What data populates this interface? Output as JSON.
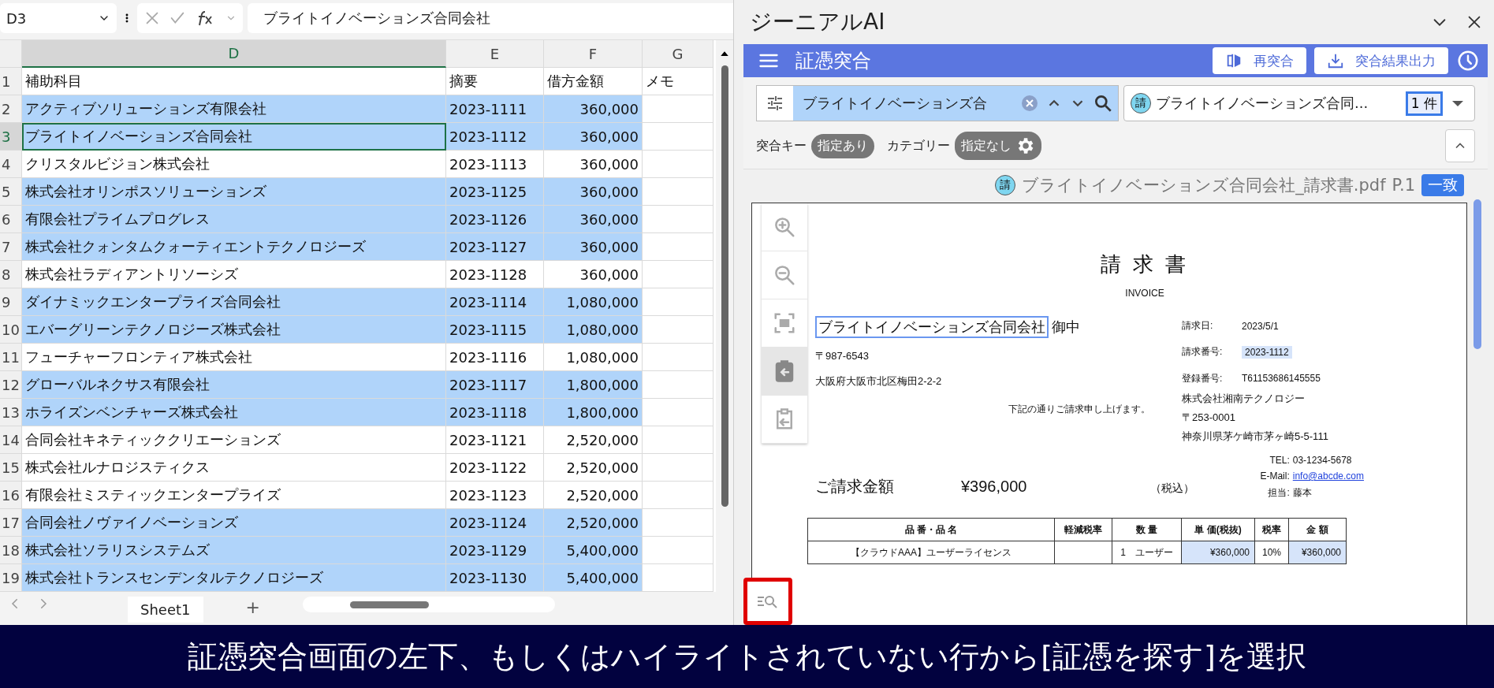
{
  "formula_bar": {
    "cell_ref": "D3",
    "value": "ブライトイノベーションズ合同会社"
  },
  "sheet": {
    "columns": [
      {
        "label": "D",
        "selected": true
      },
      {
        "label": "E",
        "selected": false
      },
      {
        "label": "F",
        "selected": false
      },
      {
        "label": "G",
        "selected": false
      }
    ],
    "rows": [
      {
        "number": "1",
        "cells": [
          "補助科目",
          "摘要",
          "借方金額",
          "メモ"
        ],
        "highlighted": false,
        "active": false
      },
      {
        "number": "2",
        "cells": [
          "アクティブソリューションズ有限会社",
          "2023-1111",
          "360,000"
        ],
        "highlighted": true,
        "active": false
      },
      {
        "number": "3",
        "cells": [
          "ブライトイノベーションズ合同会社",
          "2023-1112",
          "360,000"
        ],
        "highlighted": true,
        "active": true
      },
      {
        "number": "4",
        "cells": [
          "クリスタルビジョン株式会社",
          "2023-1113",
          "360,000"
        ],
        "highlighted": false,
        "active": false
      },
      {
        "number": "5",
        "cells": [
          "株式会社オリンポスソリューションズ",
          "2023-1125",
          "360,000"
        ],
        "highlighted": true,
        "active": false
      },
      {
        "number": "6",
        "cells": [
          "有限会社プライムプログレス",
          "2023-1126",
          "360,000"
        ],
        "highlighted": true,
        "active": false
      },
      {
        "number": "7",
        "cells": [
          "株式会社クォンタムクォーティエントテクノロジーズ",
          "2023-1127",
          "360,000"
        ],
        "highlighted": true,
        "active": false
      },
      {
        "number": "8",
        "cells": [
          "株式会社ラディアントリソーシズ",
          "2023-1128",
          "360,000"
        ],
        "highlighted": false,
        "active": false
      },
      {
        "number": "9",
        "cells": [
          "ダイナミックエンタープライズ合同会社",
          "2023-1114",
          "1,080,000"
        ],
        "highlighted": true,
        "active": false
      },
      {
        "number": "10",
        "cells": [
          "エバーグリーンテクノロジーズ株式会社",
          "2023-1115",
          "1,080,000"
        ],
        "highlighted": true,
        "active": false
      },
      {
        "number": "11",
        "cells": [
          "フューチャーフロンティア株式会社",
          "2023-1116",
          "1,080,000"
        ],
        "highlighted": false,
        "active": false
      },
      {
        "number": "12",
        "cells": [
          "グローバルネクサス有限会社",
          "2023-1117",
          "1,800,000"
        ],
        "highlighted": true,
        "active": false
      },
      {
        "number": "13",
        "cells": [
          "ホライズンベンチャーズ株式会社",
          "2023-1118",
          "1,800,000"
        ],
        "highlighted": true,
        "active": false
      },
      {
        "number": "14",
        "cells": [
          "合同会社キネティッククリエーションズ",
          "2023-1121",
          "2,520,000"
        ],
        "highlighted": false,
        "active": false
      },
      {
        "number": "15",
        "cells": [
          "株式会社ルナロジスティクス",
          "2023-1122",
          "2,520,000"
        ],
        "highlighted": false,
        "active": false
      },
      {
        "number": "16",
        "cells": [
          "有限会社ミスティックエンタープライズ",
          "2023-1123",
          "2,520,000"
        ],
        "highlighted": false,
        "active": false
      },
      {
        "number": "17",
        "cells": [
          "合同会社ノヴァイノベーションズ",
          "2023-1124",
          "2,520,000"
        ],
        "highlighted": true,
        "active": false
      },
      {
        "number": "18",
        "cells": [
          "株式会社ソラリスシステムズ",
          "2023-1129",
          "5,400,000"
        ],
        "highlighted": true,
        "active": false
      },
      {
        "number": "19",
        "cells": [
          "株式会社トランスセンデンタルテクノロジーズ",
          "2023-1130",
          "5,400,000"
        ],
        "highlighted": true,
        "active": false
      }
    ],
    "tabs": [
      {
        "label": "Sheet1",
        "selected": true
      }
    ],
    "add_tab": "+"
  },
  "panel": {
    "title": "ジーニアルAI",
    "app_bar": {
      "title": "証憑突合",
      "buttons": [
        {
          "kind": "rematch",
          "label": "再突合"
        },
        {
          "kind": "export",
          "label": "突合結果出力"
        }
      ]
    },
    "search": {
      "value": "ブライトイノベーションズ合"
    },
    "document_select": {
      "badge": "請",
      "value": "ブライトイノベーションズ合同...",
      "count": "1 件"
    },
    "filters": [
      {
        "label": "突合キー",
        "chip": "指定あり",
        "kind": "plain"
      },
      {
        "label": "カテゴリー",
        "chip": "指定なし",
        "kind": "settings"
      }
    ],
    "document_header": {
      "badge": "請",
      "filename": "ブライトイノベーションズ合同会社_請求書.pdf",
      "page": "P.1",
      "status": "一致"
    },
    "viewer_tools": [
      {
        "kind": "zoom_in",
        "selected": false
      },
      {
        "kind": "zoom_out",
        "selected": false
      },
      {
        "kind": "fit",
        "selected": false
      },
      {
        "kind": "clipboard_in",
        "selected": true
      },
      {
        "kind": "clipboard_out",
        "selected": false
      }
    ],
    "find_button": {
      "outlined": true
    },
    "invoice": {
      "title": "請 求 書",
      "subtitle": "INVOICE",
      "recipient": "ブライトイノベーションズ合同会社",
      "recipient_suffix": "御中",
      "postal": "〒987-6543",
      "address": "大阪府大阪市北区梅田2-2-2",
      "meta": [
        {
          "label": "請求日:",
          "value": "2023/5/1",
          "highlighted": false
        },
        {
          "label": "請求番号:",
          "value": "2023-1112",
          "highlighted": true
        },
        {
          "label": "登録番号:",
          "value": "T61153686145555",
          "highlighted": false
        }
      ],
      "note": "下記の通りご請求申し上げます。",
      "issuer": [
        "株式会社湘南テクノロジー",
        "〒253-0001",
        "神奈川県茅ケ崎市茅ヶ崎5-5-111"
      ],
      "contacts": [
        {
          "label": "TEL:",
          "value": "03-1234-5678",
          "kind": "text"
        },
        {
          "label": "E-Mail:",
          "value": "info@abcde.com",
          "kind": "link"
        },
        {
          "label": "担当:",
          "value": "藤本",
          "kind": "text"
        }
      ],
      "amount_label": "ご請求金額",
      "amount": "¥396,000",
      "tax_note": "（税込）",
      "table": {
        "columns": [
          "品 番・品 名",
          "軽減税率",
          "数 量",
          "単 価(税抜)",
          "税率",
          "金 額"
        ],
        "rows": [
          {
            "cells": [
              {
                "text": "【クラウドAAA】ユーザーライセンス",
                "highlighted": false
              },
              {
                "highlighted": false
              },
              {
                "text": "1　ユーザー",
                "highlighted": false
              },
              {
                "text": "¥360,000",
                "highlighted": true
              },
              {
                "text": "10%",
                "highlighted": false
              },
              {
                "text": "¥360,000",
                "highlighted": true
              }
            ]
          }
        ]
      }
    }
  },
  "caption": "証憑突合画面の左下、もしくはハイライトされていない行から[証憑を探す]を選択"
}
